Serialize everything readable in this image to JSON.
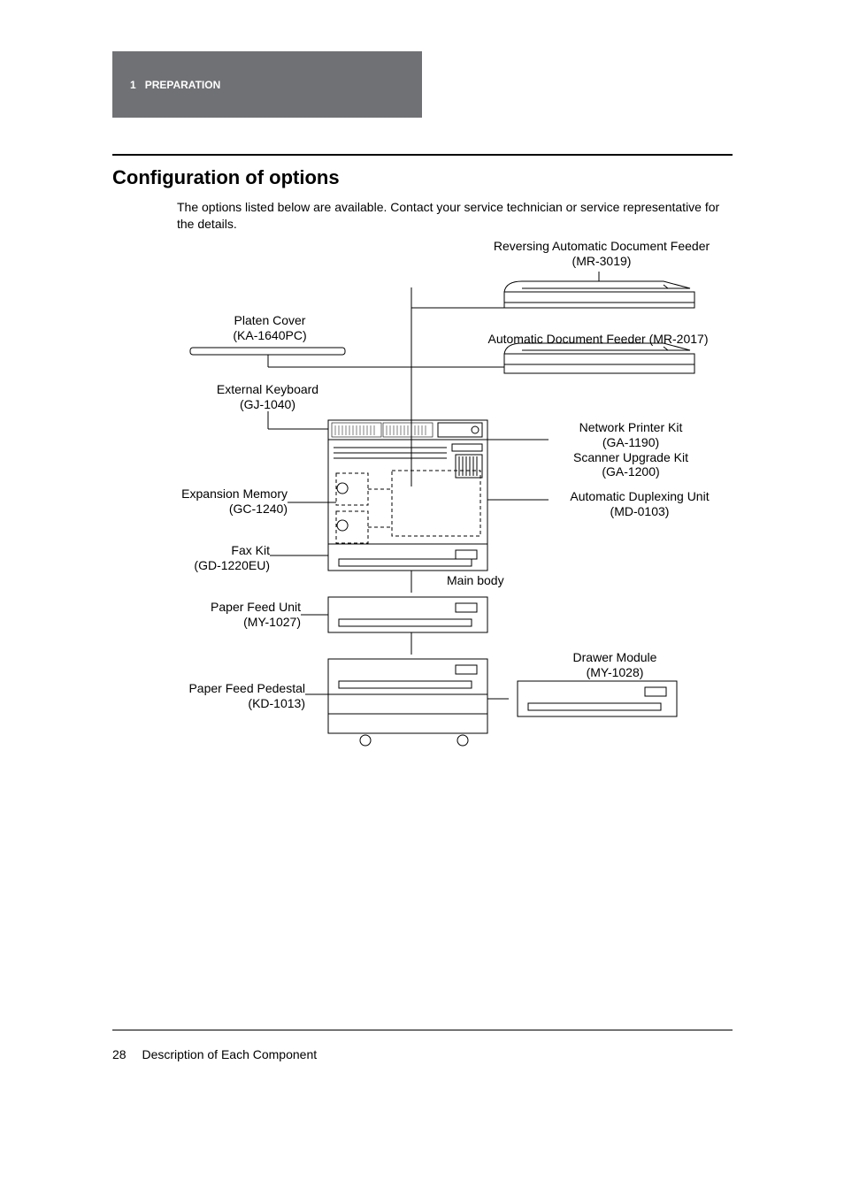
{
  "header": {
    "chapter_number": "1",
    "chapter_title": "PREPARATION"
  },
  "section": {
    "title": "Configuration of options",
    "intro": "The options listed below are available. Contact your service technician or service representative for the details."
  },
  "labels": {
    "radf": {
      "name": "Reversing Automatic Document Feeder",
      "model": "(MR-3019)"
    },
    "platen": {
      "name": "Platen Cover",
      "model": "(KA-1640PC)"
    },
    "adf": {
      "name": "Automatic Document Feeder (MR-2017)"
    },
    "ext_kbd": {
      "name": "External Keyboard",
      "model": "(GJ-1040)"
    },
    "net_printer": {
      "name": "Network Printer Kit",
      "model": "(GA-1190)"
    },
    "scanner": {
      "name": "Scanner Upgrade Kit",
      "model": "(GA-1200)"
    },
    "expansion": {
      "name": "Expansion Memory",
      "model": "(GC-1240)"
    },
    "duplex": {
      "name": "Automatic Duplexing Unit",
      "model": "(MD-0103)"
    },
    "fax": {
      "name": "Fax Kit",
      "model": "(GD-1220EU)"
    },
    "main_body": {
      "name": "Main body"
    },
    "pfu": {
      "name": "Paper Feed Unit",
      "model": "(MY-1027)"
    },
    "drawer": {
      "name": "Drawer Module",
      "model": "(MY-1028)"
    },
    "pedestal": {
      "name": "Paper Feed Pedestal",
      "model": "(KD-1013)"
    }
  },
  "footer": {
    "page_number": "28",
    "section_name": "Description of Each Component"
  }
}
